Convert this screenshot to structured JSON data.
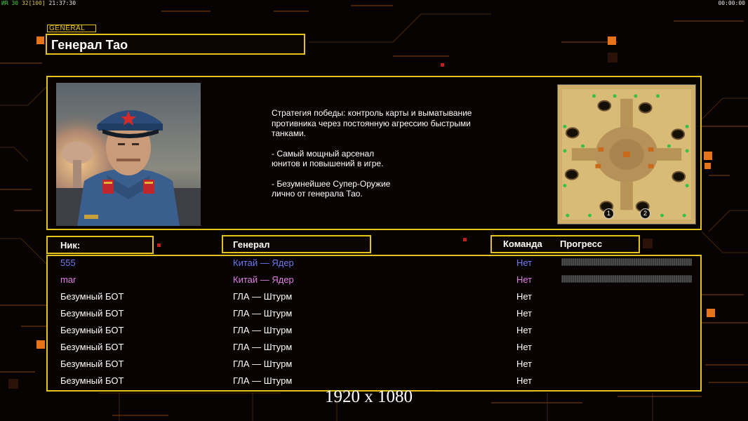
{
  "hud": {
    "left_prefix": "ИR",
    "left_value1": "30",
    "left_value2": "32",
    "left_bracket": "[100]",
    "left_time": "21:37:30",
    "right_time": "00:00:00"
  },
  "general_tag": "GENERAL",
  "general_name": "Генерал Тао",
  "description": {
    "p1": "Стратегия победы: контроль карты и выматывание\n противника через постоянную агрессию быстрыми\n танками.",
    "p2": "- Самый мощный арсенал\nюнитов и повышений в игре.",
    "p3": "- Безумнейшее Супер-Оружие\nлично от генерала Тао."
  },
  "minimap": {
    "start_labels": [
      "1",
      "2"
    ]
  },
  "columns": {
    "nick": "Ник:",
    "general": "Генерал",
    "team": "Команда",
    "progress": "Прогресс"
  },
  "players": [
    {
      "nick": "555",
      "general": "Китай — Ядер",
      "team": "Нет",
      "color": "#6e79f2",
      "progress": 0
    },
    {
      "nick": "mar",
      "general": "Китай — Ядер",
      "team": "Нет",
      "color": "#e07ee6",
      "progress": 0
    },
    {
      "nick": "Безумный БОТ",
      "general": "ГЛА — Штурм",
      "team": "Нет",
      "color": "#ffffff"
    },
    {
      "nick": "Безумный БОТ",
      "general": "ГЛА — Штурм",
      "team": "Нет",
      "color": "#ffffff"
    },
    {
      "nick": "Безумный БОТ",
      "general": "ГЛА — Штурм",
      "team": "Нет",
      "color": "#ffffff"
    },
    {
      "nick": "Безумный БОТ",
      "general": "ГЛА — Штурм",
      "team": "Нет",
      "color": "#ffffff"
    },
    {
      "nick": "Безумный БОТ",
      "general": "ГЛА — Штурм",
      "team": "Нет",
      "color": "#ffffff"
    },
    {
      "nick": "Безумный БОТ",
      "general": "ГЛА — Штурм",
      "team": "Нет",
      "color": "#ffffff"
    }
  ],
  "watermark": "1920 x 1080",
  "colors": {
    "accent": "#e3c21a",
    "background": "#070302",
    "circuit": "#e8741a"
  }
}
